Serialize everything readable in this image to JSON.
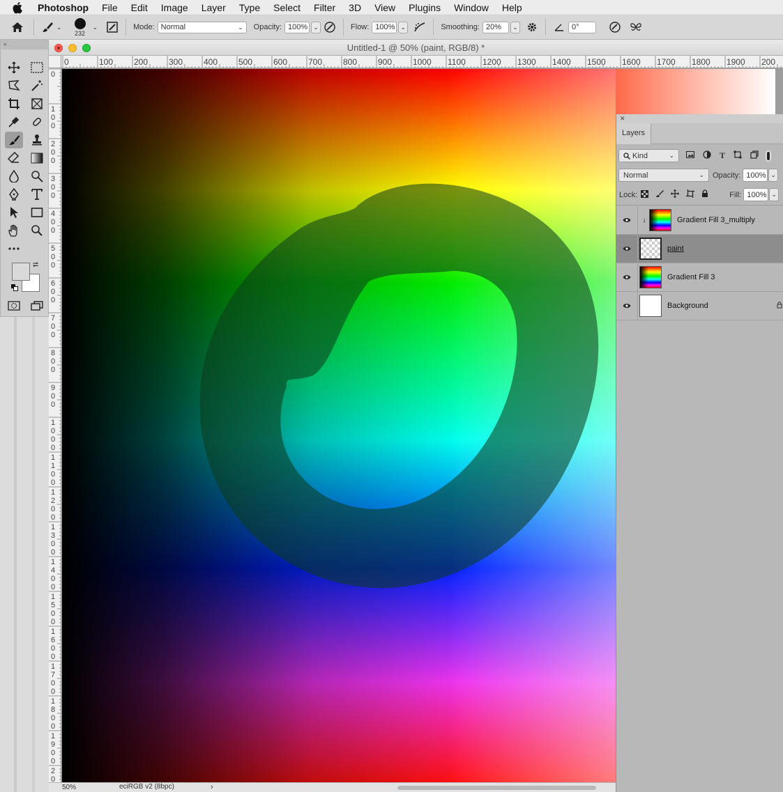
{
  "menubar": {
    "app_name": "Photoshop",
    "items": [
      "File",
      "Edit",
      "Image",
      "Layer",
      "Type",
      "Select",
      "Filter",
      "3D",
      "View",
      "Plugins",
      "Window",
      "Help"
    ]
  },
  "options": {
    "brush_size": "232",
    "mode_label": "Mode:",
    "mode_value": "Normal",
    "opacity_label": "Opacity:",
    "opacity_value": "100%",
    "flow_label": "Flow:",
    "flow_value": "100%",
    "smoothing_label": "Smoothing:",
    "smoothing_value": "20%",
    "angle_value": "0°"
  },
  "document": {
    "title": "Untitled-1 @ 50% (paint, RGB/8) *",
    "zoom": "50%",
    "profile": "eciRGB v2 (8bpc)",
    "ruler_h": [
      "0",
      "100",
      "200",
      "300",
      "400",
      "500",
      "600",
      "700",
      "800",
      "900",
      "1000",
      "1100",
      "1200",
      "1300",
      "1400",
      "1500",
      "1600",
      "1700",
      "1800",
      "1900",
      "200"
    ],
    "ruler_v": [
      "0",
      "1\n0\n0",
      "2\n0\n0",
      "3\n0\n0",
      "4\n0\n0",
      "5\n0\n0",
      "6\n0\n0",
      "7\n0\n0",
      "8\n0\n0",
      "9\n0\n0",
      "1\n0\n0\n0",
      "1\n1\n0\n0",
      "1\n2\n0\n0",
      "1\n3\n0\n0",
      "1\n4\n0\n0",
      "1\n5\n0\n0",
      "1\n6\n0\n0",
      "1\n7\n0\n0",
      "1\n8\n0\n0",
      "1\n9\n0\n0",
      "2\n0"
    ]
  },
  "layers_panel": {
    "tab": "Layers",
    "filter_kind": "Kind",
    "blend_mode": "Normal",
    "opacity_label": "Opacity:",
    "opacity_value": "100%",
    "lock_label": "Lock:",
    "fill_label": "Fill:",
    "fill_value": "100%",
    "layers": [
      {
        "name": "Gradient Fill 3_multiply"
      },
      {
        "name": "paint"
      },
      {
        "name": "Gradient Fill 3"
      },
      {
        "name": "Background"
      }
    ]
  },
  "colors": {
    "foreground": "#d9d9d9",
    "background": "#ffffff"
  }
}
